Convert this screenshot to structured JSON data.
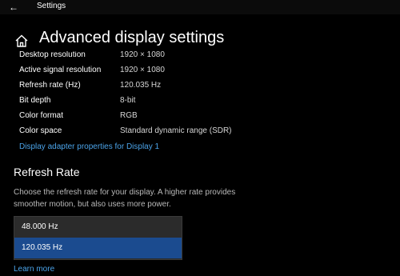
{
  "window": {
    "back_glyph": "←",
    "title": "Settings"
  },
  "header": {
    "title": "Advanced display settings",
    "icon": "home-icon"
  },
  "display_info": [
    {
      "label": "Desktop resolution",
      "value": "1920 × 1080"
    },
    {
      "label": "Active signal resolution",
      "value": "1920 × 1080"
    },
    {
      "label": "Refresh rate (Hz)",
      "value": "120.035 Hz"
    },
    {
      "label": "Bit depth",
      "value": "8-bit"
    },
    {
      "label": "Color format",
      "value": "RGB"
    },
    {
      "label": "Color space",
      "value": "Standard dynamic range (SDR)"
    }
  ],
  "adapter_link": "Display adapter properties for Display 1",
  "refresh_rate": {
    "title": "Refresh Rate",
    "description": "Choose the refresh rate for your display. A higher rate provides smoother motion, but also uses more power.",
    "options": [
      {
        "label": "48.000 Hz",
        "selected": false
      },
      {
        "label": "120.035 Hz",
        "selected": true
      }
    ]
  },
  "learn_more": "Learn more",
  "colors": {
    "background": "#000000",
    "accent_link": "#4ba3e8",
    "selected_option": "#1b4b8f",
    "list_background": "#2b2b2b"
  }
}
